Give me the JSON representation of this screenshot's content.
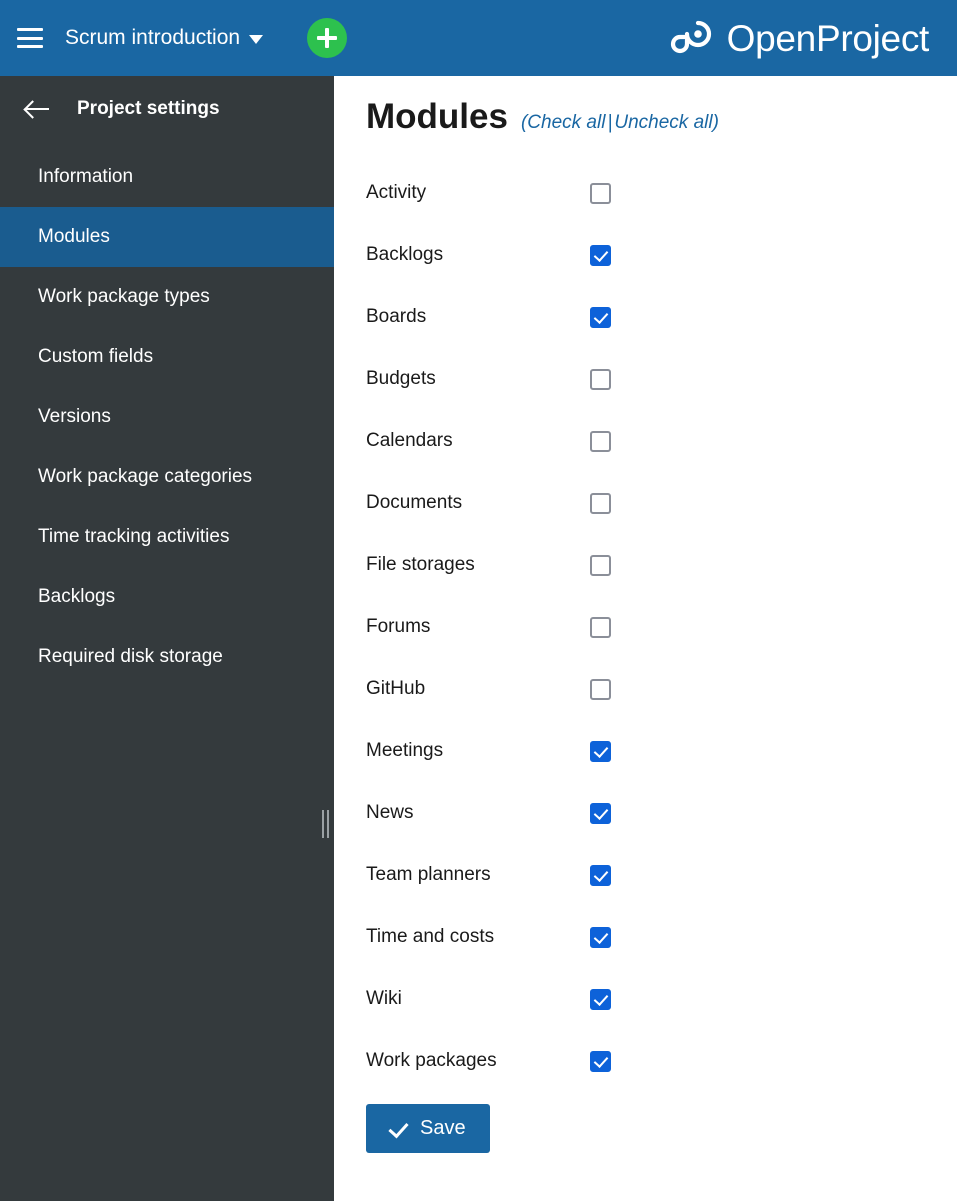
{
  "header": {
    "menu_icon": "hamburger-menu-icon",
    "project_name": "Scrum introduction",
    "dropdown_icon": "chevron-down-icon",
    "add_icon": "plus-icon",
    "brand_name": "OpenProject",
    "brand_logo_icon": "openproject-logo-icon",
    "background_color": "#1a67a3",
    "add_button_color": "#2dc14e"
  },
  "sidebar": {
    "back_icon": "arrow-left-icon",
    "title": "Project settings",
    "background_color": "#343a3d",
    "active_color": "#1a5c8f",
    "items": [
      {
        "label": "Information",
        "active": false
      },
      {
        "label": "Modules",
        "active": true
      },
      {
        "label": "Work package types",
        "active": false
      },
      {
        "label": "Custom fields",
        "active": false
      },
      {
        "label": "Versions",
        "active": false
      },
      {
        "label": "Work package categories",
        "active": false
      },
      {
        "label": "Time tracking activities",
        "active": false
      },
      {
        "label": "Backlogs",
        "active": false
      },
      {
        "label": "Required disk storage",
        "active": false
      }
    ],
    "resize_handle_icon": "resize-grip-icon"
  },
  "main": {
    "title": "Modules",
    "bulk": {
      "open_paren": "(",
      "check_all": "Check all",
      "separator": "|",
      "uncheck_all": "Uncheck all",
      "close_paren": ")",
      "link_color": "#1a67a3"
    },
    "checkbox_checked_color": "#0d62d9",
    "checkbox_border_color": "#8b8f99",
    "modules": [
      {
        "label": "Activity",
        "checked": false
      },
      {
        "label": "Backlogs",
        "checked": true
      },
      {
        "label": "Boards",
        "checked": true
      },
      {
        "label": "Budgets",
        "checked": false
      },
      {
        "label": "Calendars",
        "checked": false
      },
      {
        "label": "Documents",
        "checked": false
      },
      {
        "label": "File storages",
        "checked": false
      },
      {
        "label": "Forums",
        "checked": false
      },
      {
        "label": "GitHub",
        "checked": false
      },
      {
        "label": "Meetings",
        "checked": true
      },
      {
        "label": "News",
        "checked": true
      },
      {
        "label": "Team planners",
        "checked": true
      },
      {
        "label": "Time and costs",
        "checked": true
      },
      {
        "label": "Wiki",
        "checked": true
      },
      {
        "label": "Work packages",
        "checked": true
      }
    ],
    "save": {
      "label": "Save",
      "icon": "check-icon",
      "color": "#1a67a3"
    }
  }
}
